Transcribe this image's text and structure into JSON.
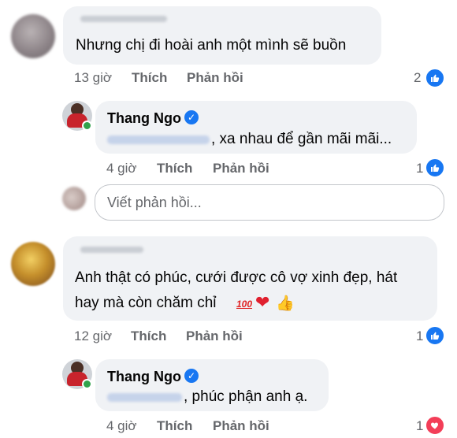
{
  "comments": [
    {
      "text": "Nhưng chị đi hoài anh một mình sẽ buồn",
      "time": "13 giờ",
      "like_label": "Thích",
      "reply_label": "Phản hồi",
      "reaction_count": "2",
      "reaction_icon": "thumbs-up-icon",
      "reply": {
        "author": "Thang Ngo",
        "verified_icon": "verified-check-icon",
        "text": ", xa nhau để gần mãi mãi...",
        "time": "4 giờ",
        "like_label": "Thích",
        "reply_label": "Phản hồi",
        "reaction_count": "1",
        "reaction_icon": "thumbs-up-icon"
      }
    },
    {
      "text_line1": "Anh thật có phúc, cưới được cô vợ xinh đẹp, hát",
      "text_line2": "hay mà còn chăm chỉ",
      "emoji_100": "100",
      "emoji_heart": "❤",
      "emoji_thumb": "👍",
      "time": "12 giờ",
      "like_label": "Thích",
      "reply_label": "Phản hồi",
      "reaction_count": "1",
      "reaction_icon": "thumbs-up-icon",
      "reply": {
        "author": "Thang Ngo",
        "verified_icon": "verified-check-icon",
        "text": ", phúc phận anh ạ.",
        "time": "4 giờ",
        "like_label": "Thích",
        "reply_label": "Phản hồi",
        "reaction_count": "1",
        "reaction_icon": "heart-icon"
      }
    }
  ],
  "reply_box": {
    "placeholder": "Viết phản hồi..."
  },
  "colors": {
    "like_blue": "#1877f2",
    "heart_red": "#f33e58",
    "bubble": "#f0f2f5",
    "meta_gray": "#65676b"
  }
}
